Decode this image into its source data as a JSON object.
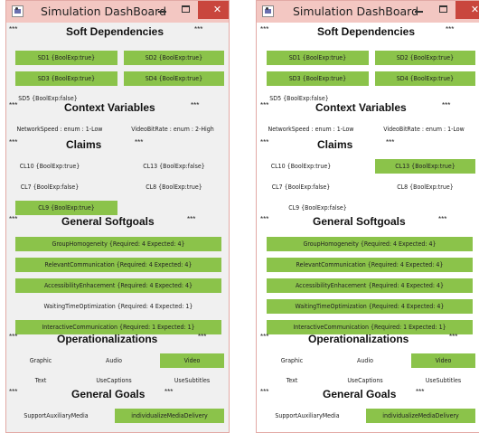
{
  "window_title": "Simulation DashBoard",
  "controls": {
    "close": "✕"
  },
  "stars": "***",
  "snapshots": [
    {
      "soft_dependencies": {
        "title": "Soft Dependencies",
        "items": [
          {
            "label": "SD1 {BoolExp:true}",
            "active": true
          },
          {
            "label": "SD2 {BoolExp:true}",
            "active": true
          },
          {
            "label": "SD3 {BoolExp:true}",
            "active": true
          },
          {
            "label": "SD4 {BoolExp:true}",
            "active": true
          },
          {
            "label": "SD5 {BoolExp:false}",
            "active": false
          }
        ]
      },
      "context_variables": {
        "title": "Context Variables",
        "items": [
          {
            "label": "NetworkSpeed  : enum : 1-Low"
          },
          {
            "label": "VideoBitRate  : enum : 2-High"
          }
        ]
      },
      "claims": {
        "title": "Claims",
        "items": [
          {
            "label": "CL10 {BoolExp:true}",
            "active": false
          },
          {
            "label": "CL13 {BoolExp:false}",
            "active": false
          },
          {
            "label": "CL7 {BoolExp:false}",
            "active": false
          },
          {
            "label": "CL8 {BoolExp:true}",
            "active": false
          },
          {
            "label": "CL9 {BoolExp:true}",
            "active": true
          }
        ]
      },
      "general_softgoals": {
        "title": "General Softgoals",
        "items": [
          {
            "label": "GroupHomogeneity  {Required: 4 Expected: 4}",
            "active": true
          },
          {
            "label": "RelevantCommunication  {Required: 4 Expected: 4}",
            "active": true
          },
          {
            "label": "AccessibilityEnhacement  {Required: 4 Expected: 4}",
            "active": true
          },
          {
            "label": "WaitingTimeOptimization  {Required: 4 Expected: 1}",
            "active": false
          },
          {
            "label": "InteractiveCommunication  {Required: 1 Expected: 1}",
            "active": true
          }
        ]
      },
      "operationalizations": {
        "title": "Operationalizations",
        "items": [
          {
            "label": "Graphic",
            "active": false
          },
          {
            "label": "Audio",
            "active": false
          },
          {
            "label": "Video",
            "active": true
          },
          {
            "label": "Text",
            "active": false
          },
          {
            "label": "UseCaptions",
            "active": false
          },
          {
            "label": "UseSubtitles",
            "active": false
          }
        ]
      },
      "general_goals": {
        "title": "General Goals",
        "items": [
          {
            "label": "SupportAuxiliaryMedia",
            "active": false
          },
          {
            "label": "individualizeMediaDelivery",
            "active": true
          }
        ]
      }
    },
    {
      "soft_dependencies": {
        "title": "Soft Dependencies",
        "items": [
          {
            "label": "SD1 {BoolExp:true}",
            "active": true
          },
          {
            "label": "SD2 {BoolExp:true}",
            "active": true
          },
          {
            "label": "SD3 {BoolExp:true}",
            "active": true
          },
          {
            "label": "SD4 {BoolExp:true}",
            "active": true
          },
          {
            "label": "SD5 {BoolExp:false}",
            "active": false
          }
        ]
      },
      "context_variables": {
        "title": "Context Variables",
        "items": [
          {
            "label": "NetworkSpeed  : enum : 1-Low"
          },
          {
            "label": "VideoBitRate  : enum : 1-Low"
          }
        ]
      },
      "claims": {
        "title": "Claims",
        "items": [
          {
            "label": "CL10 {BoolExp:true}",
            "active": false
          },
          {
            "label": "CL13 {BoolExp:true}",
            "active": true
          },
          {
            "label": "CL7 {BoolExp:false}",
            "active": false
          },
          {
            "label": "CL8 {BoolExp:true}",
            "active": false
          },
          {
            "label": "CL9 {BoolExp:false}",
            "active": false
          }
        ]
      },
      "general_softgoals": {
        "title": "General Softgoals",
        "items": [
          {
            "label": "GroupHomogeneity  {Required: 4 Expected: 4}",
            "active": true
          },
          {
            "label": "RelevantCommunication  {Required: 4 Expected: 4}",
            "active": true
          },
          {
            "label": "AccessibilityEnhacement  {Required: 4 Expected: 4}",
            "active": true
          },
          {
            "label": "WaitingTimeOptimization  {Required: 4 Expected: 4}",
            "active": true
          },
          {
            "label": "InteractiveCommunication  {Required: 1 Expected: 1}",
            "active": true
          }
        ]
      },
      "operationalizations": {
        "title": "Operationalizations",
        "items": [
          {
            "label": "Graphic",
            "active": false
          },
          {
            "label": "Audio",
            "active": false
          },
          {
            "label": "Video",
            "active": true
          },
          {
            "label": "Text",
            "active": false
          },
          {
            "label": "UseCaptions",
            "active": false
          },
          {
            "label": "UseSubtitles",
            "active": false
          }
        ]
      },
      "general_goals": {
        "title": "General Goals",
        "items": [
          {
            "label": "SupportAuxiliaryMedia",
            "active": false
          },
          {
            "label": "individualizeMediaDelivery",
            "active": true
          }
        ]
      }
    }
  ]
}
